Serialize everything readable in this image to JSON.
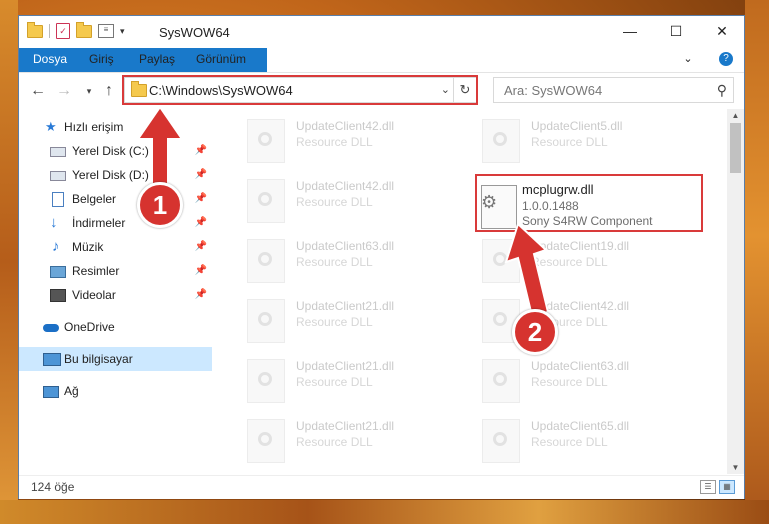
{
  "window": {
    "title": "SysWOW64",
    "controls": {
      "minimize": "—",
      "maximize": "☐",
      "close": "✕"
    }
  },
  "ribbon": {
    "tabs": [
      "Dosya",
      "Giriş",
      "Paylaş",
      "Görünüm"
    ]
  },
  "address_bar": {
    "path": "C:\\Windows\\SysWOW64",
    "search_placeholder": "Ara: SysWOW64"
  },
  "nav_pane": {
    "quick_access": "Hızlı erişim",
    "items": [
      {
        "label": "Yerel Disk (C:)",
        "icon": "drive-icon",
        "pinned": true
      },
      {
        "label": "Yerel Disk (D:)",
        "icon": "drive-icon",
        "pinned": true
      },
      {
        "label": "Belgeler",
        "icon": "documents-icon",
        "pinned": true
      },
      {
        "label": "İndirmeler",
        "icon": "download-icon",
        "pinned": true
      },
      {
        "label": "Müzik",
        "icon": "music-icon",
        "pinned": true
      },
      {
        "label": "Resimler",
        "icon": "pictures-icon",
        "pinned": true
      },
      {
        "label": "Videolar",
        "icon": "videos-icon",
        "pinned": true
      }
    ],
    "onedrive": "OneDrive",
    "this_pc": "Bu bilgisayar",
    "network": "Ağ"
  },
  "files": {
    "left_column": [
      {
        "name": "UpdateClient42.dll",
        "type": "Resource DLL"
      },
      {
        "name": "UpdateClient42.dll",
        "type": "Resource DLL"
      },
      {
        "name": "UpdateClient63.dll",
        "type": "Resource DLL"
      },
      {
        "name": "UpdateClient21.dll",
        "type": "Resource DLL"
      },
      {
        "name": "UpdateClient21.dll",
        "type": "Resource DLL"
      },
      {
        "name": "UpdateClient21.dll",
        "type": "Resource DLL"
      }
    ],
    "right_column": [
      {
        "name": "UpdateClient5.dll",
        "type": "Resource DLL"
      },
      {
        "name": "UpdateClient19.dll",
        "type": "Resource DLL"
      },
      {
        "name": "UpdateClient42.dll",
        "type": "Resource DLL"
      },
      {
        "name": "UpdateClient63.dll",
        "type": "Resource DLL"
      },
      {
        "name": "UpdateClient65.dll",
        "type": "Resource DLL"
      }
    ],
    "highlighted": {
      "name": "mcplugrw.dll",
      "version": "1.0.0.1488",
      "component": "Sony S4RW Component"
    }
  },
  "status": {
    "item_count": "124 öğe"
  },
  "annotations": {
    "step1": "1",
    "step2": "2",
    "highlight_color": "#d93a3a"
  }
}
